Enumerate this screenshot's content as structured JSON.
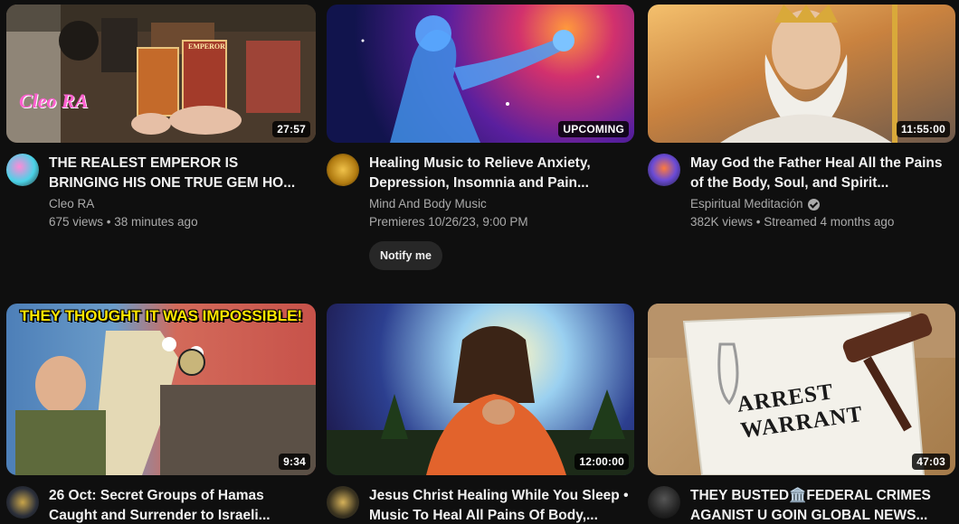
{
  "videos": [
    {
      "title": "THE REALEST EMPEROR IS BRINGING HIS ONE TRUE GEM HO...",
      "channel": "Cleo RA",
      "stats": "675 views • 38 minutes ago",
      "duration": "27:57",
      "thumb_text": "EMPEROR",
      "thumb_logo": "Cleo RA"
    },
    {
      "title": "Healing Music to Relieve Anxiety, Depression, Insomnia and Pain...",
      "channel": "Mind And Body Music",
      "stats": "Premieres 10/26/23, 9:00 PM",
      "duration": "UPCOMING",
      "notify_label": "Notify me"
    },
    {
      "title": "May God the Father Heal All the Pains of the Body, Soul, and Spirit...",
      "channel": "Espiritual Meditación",
      "stats": "382K views • Streamed 4 months ago",
      "duration": "11:55:00",
      "verified": true
    },
    {
      "title": "26 Oct: Secret Groups of Hamas Caught and Surrender to Israeli...",
      "channel": "",
      "stats": "",
      "duration": "9:34",
      "thumb_text": "THEY THOUGHT IT WAS IMPOSSIBLE!"
    },
    {
      "title": "Jesus Christ Healing While You Sleep • Music To Heal All Pains Of Body,...",
      "channel": "",
      "stats": "",
      "duration": "12:00:00"
    },
    {
      "title": "THEY BUSTED🏛️FEDERAL CRIMES AGANIST U GOIN GLOBAL NEWS...",
      "channel": "",
      "stats": "",
      "duration": "47:03",
      "thumb_text": "ARREST WARRANT"
    }
  ],
  "colors": {
    "background": "#0f0f0f",
    "title": "#f1f1f1",
    "secondary_text": "#aaaaaa",
    "notify_button": "#272727"
  },
  "icons": [
    "verified-check-icon"
  ]
}
